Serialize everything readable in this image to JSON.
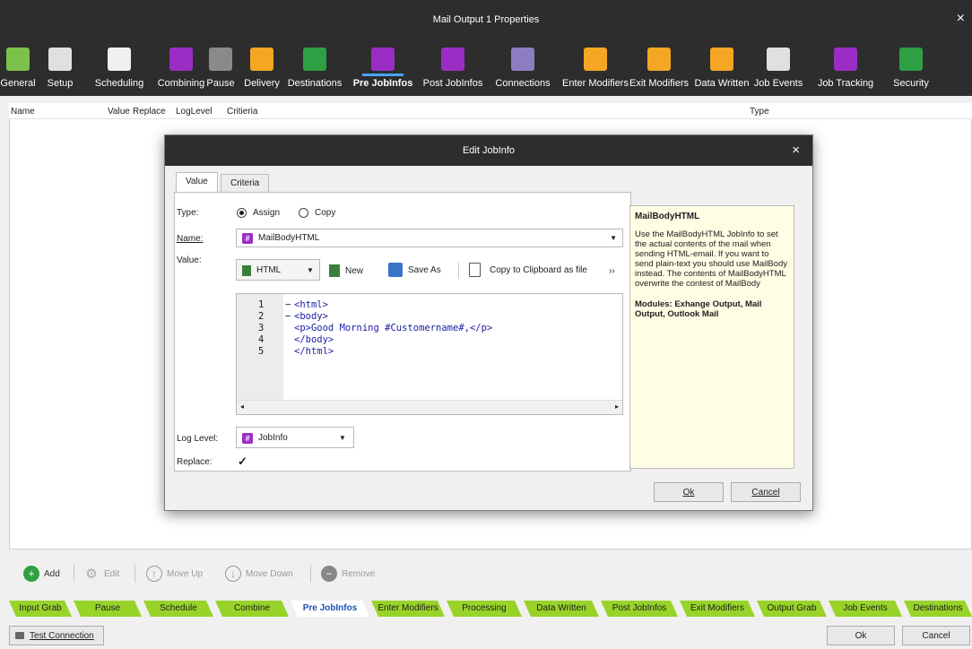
{
  "window": {
    "title": "Mail Output 1 Properties",
    "close": "×"
  },
  "toolbar": [
    {
      "label": "General",
      "icon": "toggle-icon",
      "color": "#7cc24a"
    },
    {
      "label": "Setup",
      "icon": "envelope-icon",
      "color": "#e0e0e0"
    },
    {
      "label": "Scheduling",
      "icon": "calendar-icon",
      "color": "#f0f0f0"
    },
    {
      "label": "Combining",
      "icon": "merge-icon",
      "color": "#9b2dc4"
    },
    {
      "label": "Pause",
      "icon": "pause-icon",
      "color": "#8a8a8a"
    },
    {
      "label": "Delivery",
      "icon": "delivery-icon",
      "color": "#f5a623"
    },
    {
      "label": "Destinations",
      "icon": "arrow-right-icon",
      "color": "#2ea043"
    },
    {
      "label": "Pre JobInfos",
      "icon": "hash-icon",
      "color": "#9b2dc4",
      "active": true
    },
    {
      "label": "Post JobInfos",
      "icon": "hash-up-icon",
      "color": "#9b2dc4"
    },
    {
      "label": "Connections",
      "icon": "database-icon",
      "color": "#8e7cc3"
    },
    {
      "label": "Enter Modifiers",
      "icon": "enter-modifier-icon",
      "color": "#f5a623"
    },
    {
      "label": "Exit Modifiers",
      "icon": "exit-modifier-icon",
      "color": "#f5a623"
    },
    {
      "label": "Data Written",
      "icon": "data-written-icon",
      "color": "#f5a623"
    },
    {
      "label": "Job Events",
      "icon": "checkered-flag-icon",
      "color": "#e0e0e0"
    },
    {
      "label": "Job Tracking",
      "icon": "hash-track-icon",
      "color": "#9b2dc4"
    },
    {
      "label": "Security",
      "icon": "shield-icon",
      "color": "#2ea043"
    }
  ],
  "grid": {
    "columns": [
      "Name",
      "Value",
      "Replace",
      "LogLevel",
      "Critieria",
      "Type"
    ]
  },
  "actions": {
    "add": "Add",
    "edit": "Edit",
    "move_up": "Move Up",
    "move_down": "Move Down",
    "remove": "Remove"
  },
  "steps": [
    "Input Grab",
    "Pause",
    "Schedule",
    "Combine",
    "Pre JobInfos",
    "Enter Modifiers",
    "Processing",
    "Data Written",
    "Post JobInfos",
    "Exit Modifiers",
    "Output Grab",
    "Job Events",
    "Destinations"
  ],
  "active_step": "Pre JobInfos",
  "bottom": {
    "test_connection": "Test Connection",
    "ok": "Ok",
    "cancel": "Cancel"
  },
  "dialog": {
    "title": "Edit JobInfo",
    "close": "×",
    "tabs": [
      "Value",
      "Criteria"
    ],
    "type_label": "Type:",
    "type_options": [
      "Assign",
      "Copy"
    ],
    "type_selected": "Assign",
    "name_label": "Name:",
    "name_value": "MailBodyHTML",
    "value_label": "Value:",
    "format": "HTML",
    "new_label": "New",
    "save_as_label": "Save As",
    "copy_label": "Copy to Clipboard as file",
    "more": "››",
    "code_lines": [
      {
        "n": "1",
        "fold": "−",
        "text": "<html>"
      },
      {
        "n": "2",
        "fold": "−",
        "text": "<body>"
      },
      {
        "n": "3",
        "fold": "",
        "text": "<p>Good Morning #Customername#,</p>"
      },
      {
        "n": "4",
        "fold": "",
        "text": "</body>"
      },
      {
        "n": "5",
        "fold": "",
        "text": "</html>"
      }
    ],
    "log_level_label": "Log Level:",
    "log_level_value": "JobInfo",
    "replace_label": "Replace:",
    "replace_checked": "✓",
    "help_title": "MailBodyHTML",
    "help_text": "Use the MailBodyHTML JobInfo to set the actual contents of the mail when sending HTML-email. If you want to send plain-text you should use MailBody instead. The contents of MailBodyHTML overwrite the contest of MailBody",
    "help_modules": "Modules: Exhange Output, Mail Output, Outlook Mail",
    "ok": "Ok",
    "cancel": "Cancel"
  }
}
